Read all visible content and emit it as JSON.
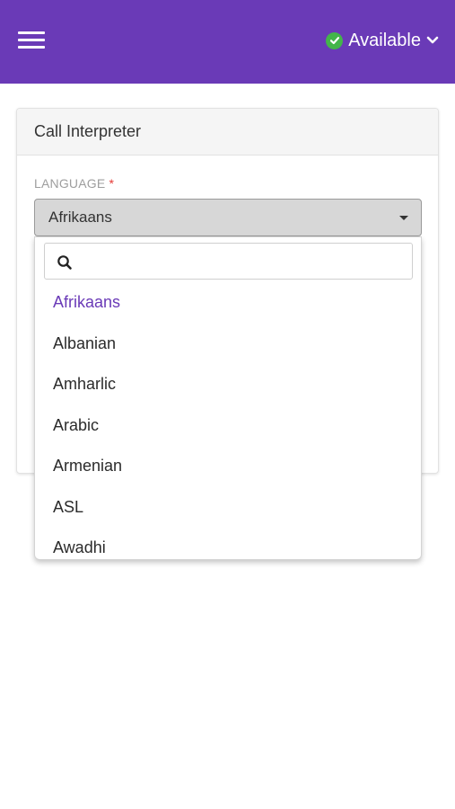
{
  "header": {
    "status_label": "Available",
    "status_color": "#43b54a",
    "brand_color": "#6a3ab7",
    "icons": [
      "menu-icon",
      "check-icon",
      "chevron-down-icon"
    ]
  },
  "card": {
    "title": "Call Interpreter",
    "language_field": {
      "label": "LANGUAGE",
      "required_marker": "*",
      "selected_value": "Afrikaans"
    }
  },
  "dropdown": {
    "search_placeholder": "",
    "options": [
      {
        "label": "Afrikaans",
        "selected": true
      },
      {
        "label": "Albanian",
        "selected": false
      },
      {
        "label": "Amharlic",
        "selected": false
      },
      {
        "label": "Arabic",
        "selected": false
      },
      {
        "label": "Armenian",
        "selected": false
      },
      {
        "label": "ASL",
        "selected": false
      },
      {
        "label": "Awadhi",
        "selected": false
      }
    ]
  }
}
